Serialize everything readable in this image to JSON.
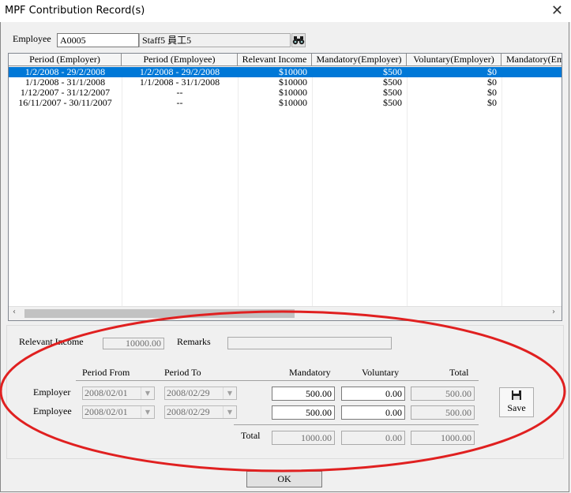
{
  "window": {
    "title": "MPF Contribution Record(s)",
    "close_glyph": "✕"
  },
  "employee": {
    "label": "Employee",
    "code": "A0005",
    "name": "Staff5  員工5"
  },
  "table": {
    "columns": [
      "Period (Employer)",
      "Period (Employee)",
      "Relevant Income",
      "Mandatory(Employer)",
      "Voluntary(Employer)",
      "Mandatory(Em"
    ],
    "rows": [
      [
        "1/2/2008 - 29/2/2008",
        "1/2/2008 - 29/2/2008",
        "$10000",
        "$500",
        "$0",
        ""
      ],
      [
        "1/1/2008 - 31/1/2008",
        "1/1/2008 - 31/1/2008",
        "$10000",
        "$500",
        "$0",
        ""
      ],
      [
        "1/12/2007 - 31/12/2007",
        "--",
        "$10000",
        "$500",
        "$0",
        ""
      ],
      [
        "16/11/2007 - 30/11/2007",
        "--",
        "$10000",
        "$500",
        "$0",
        ""
      ]
    ],
    "selected_row": 0,
    "scroll_left": "‹",
    "scroll_right": "›"
  },
  "detail": {
    "relevant_income_label": "Relevant Income",
    "relevant_income_value": "10000.00",
    "remarks_label": "Remarks",
    "remarks_value": "",
    "headers": {
      "period_from": "Period From",
      "period_to": "Period To",
      "mandatory": "Mandatory",
      "voluntary": "Voluntary",
      "total": "Total"
    },
    "employer": {
      "label": "Employer",
      "from": "2008/02/01",
      "to": "2008/02/29",
      "mandatory": "500.00",
      "voluntary": "0.00",
      "total": "500.00"
    },
    "employee": {
      "label": "Employee",
      "from": "2008/02/01",
      "to": "2008/02/29",
      "mandatory": "500.00",
      "voluntary": "0.00",
      "total": "500.00"
    },
    "totals": {
      "label": "Total",
      "mandatory": "1000.00",
      "voluntary": "0.00",
      "total": "1000.00"
    },
    "dropdown_glyph": "▼"
  },
  "buttons": {
    "save": "Save",
    "ok": "OK"
  },
  "colors": {
    "selection": "#0078d7",
    "annotation": "#e02020"
  }
}
